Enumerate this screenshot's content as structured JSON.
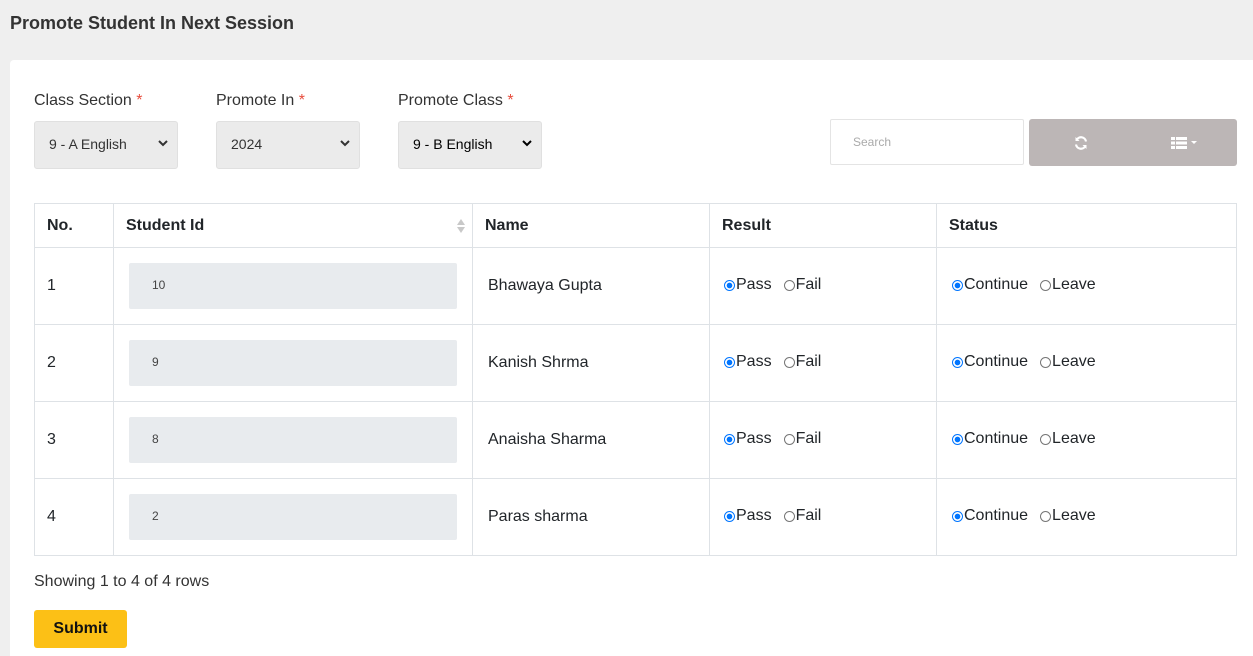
{
  "page": {
    "title": "Promote Student In Next Session"
  },
  "filters": {
    "class_section": {
      "label": "Class Section",
      "required": "*",
      "value": "9 - A English"
    },
    "promote_in": {
      "label": "Promote In",
      "required": "*",
      "value": "2024"
    },
    "promote_class": {
      "label": "Promote Class",
      "required": "*",
      "value": "9 - B English"
    }
  },
  "toolbar": {
    "search_placeholder": "Search",
    "refresh_icon": "refresh-icon",
    "columns_icon": "columns-list-icon"
  },
  "table": {
    "headers": {
      "no": "No.",
      "student_id": "Student Id",
      "name": "Name",
      "result": "Result",
      "status": "Status"
    },
    "rows": [
      {
        "no": "1",
        "student_id": "10",
        "name": "Bhawaya Gupta",
        "result": "Pass",
        "status": "Continue"
      },
      {
        "no": "2",
        "student_id": "9",
        "name": "Kanish Shrma",
        "result": "Pass",
        "status": "Continue"
      },
      {
        "no": "3",
        "student_id": "8",
        "name": "Anaisha Sharma",
        "result": "Pass",
        "status": "Continue"
      },
      {
        "no": "4",
        "student_id": "2",
        "name": "Paras sharma",
        "result": "Pass",
        "status": "Continue"
      }
    ],
    "result_options": {
      "pass": "Pass",
      "fail": "Fail"
    },
    "status_options": {
      "continue": "Continue",
      "leave": "Leave"
    }
  },
  "footer": {
    "showing": "Showing 1 to 4 of 4 rows",
    "submit_label": "Submit"
  },
  "colors": {
    "submit_bg": "#fcc016",
    "toolbar_btn_bg": "#bcb6b6",
    "radio_checked": "#0075ff"
  }
}
